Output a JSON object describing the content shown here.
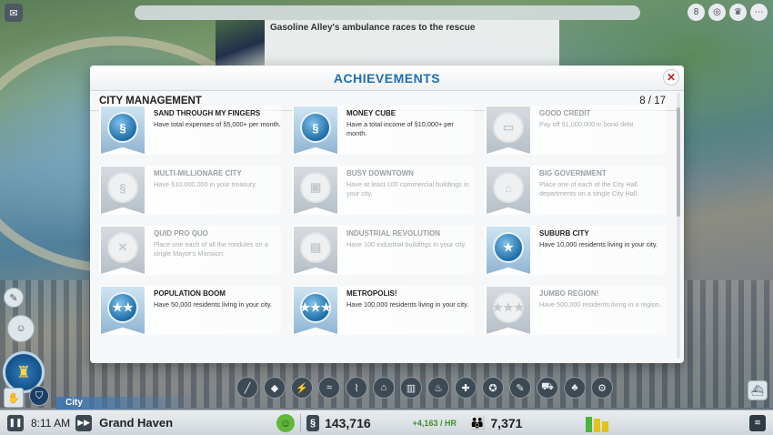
{
  "news": {
    "headline": "Gasoline Alley's ambulance races to the rescue"
  },
  "modal": {
    "title": "ACHIEVEMENTS",
    "close_icon": "close-icon",
    "section_title": "CITY MANAGEMENT",
    "progress": "8 / 17"
  },
  "achievements": [
    {
      "name": "SAND THROUGH MY FINGERS",
      "desc": "Have total expenses of §5,000+ per month.",
      "status": "earned",
      "icon": "§"
    },
    {
      "name": "MONEY CUBE",
      "desc": "Have a total income of §10,000+ per month.",
      "status": "earned",
      "icon": "§"
    },
    {
      "name": "GOOD CREDIT",
      "desc": "Pay off §1,000,000 in bond debt",
      "status": "locked",
      "icon": "▭"
    },
    {
      "name": "MULTI-MILLIONARE CITY",
      "desc": "Have §10,000,000 in your treasury.",
      "status": "locked",
      "icon": "§"
    },
    {
      "name": "BUSY DOWNTOWN",
      "desc": "Have at least 100 commercial buildings in your city.",
      "status": "locked",
      "icon": "▣"
    },
    {
      "name": "BIG GOVERNMENT",
      "desc": "Place one of each of the City Hall departments on a single City Hall.",
      "status": "locked",
      "icon": "⌂"
    },
    {
      "name": "QUID PRO QUO",
      "desc": "Place one each of all the modules on a single Mayor's Mansion.",
      "status": "locked",
      "icon": "✕"
    },
    {
      "name": "INDUSTRIAL REVOLUTION",
      "desc": "Have 100 industrial buildings in your city.",
      "status": "locked",
      "icon": "▤"
    },
    {
      "name": "SUBURB CITY",
      "desc": "Have 10,000 residents living in your city.",
      "status": "earned",
      "icon": "★"
    },
    {
      "name": "POPULATION BOOM",
      "desc": "Have 50,000 residents living in your city.",
      "status": "earned",
      "icon": "★★"
    },
    {
      "name": "METROPOLIS!",
      "desc": "Have 100,000 residents living in your city.",
      "status": "earned",
      "icon": "★★★"
    },
    {
      "name": "JUMBO REGION!",
      "desc": "Have 500,000 residents living in a region.",
      "status": "locked",
      "icon": "★★★"
    }
  ],
  "city_tab": "City",
  "status_bar": {
    "time": "8:11 AM",
    "city_name": "Grand Haven",
    "funds": "143,716",
    "income": "+4,163 / HR",
    "population": "7,371"
  },
  "colors": {
    "title_blue": "#1d6fb3",
    "earned_badge": "#1f6ea8",
    "close_red": "#c4232b",
    "rci_green": "#4fb33a",
    "rci_yellow": "#e2c419"
  },
  "rci_levels": {
    "residential": 0.85,
    "commercial": 0.75,
    "industrial": 0.6
  }
}
